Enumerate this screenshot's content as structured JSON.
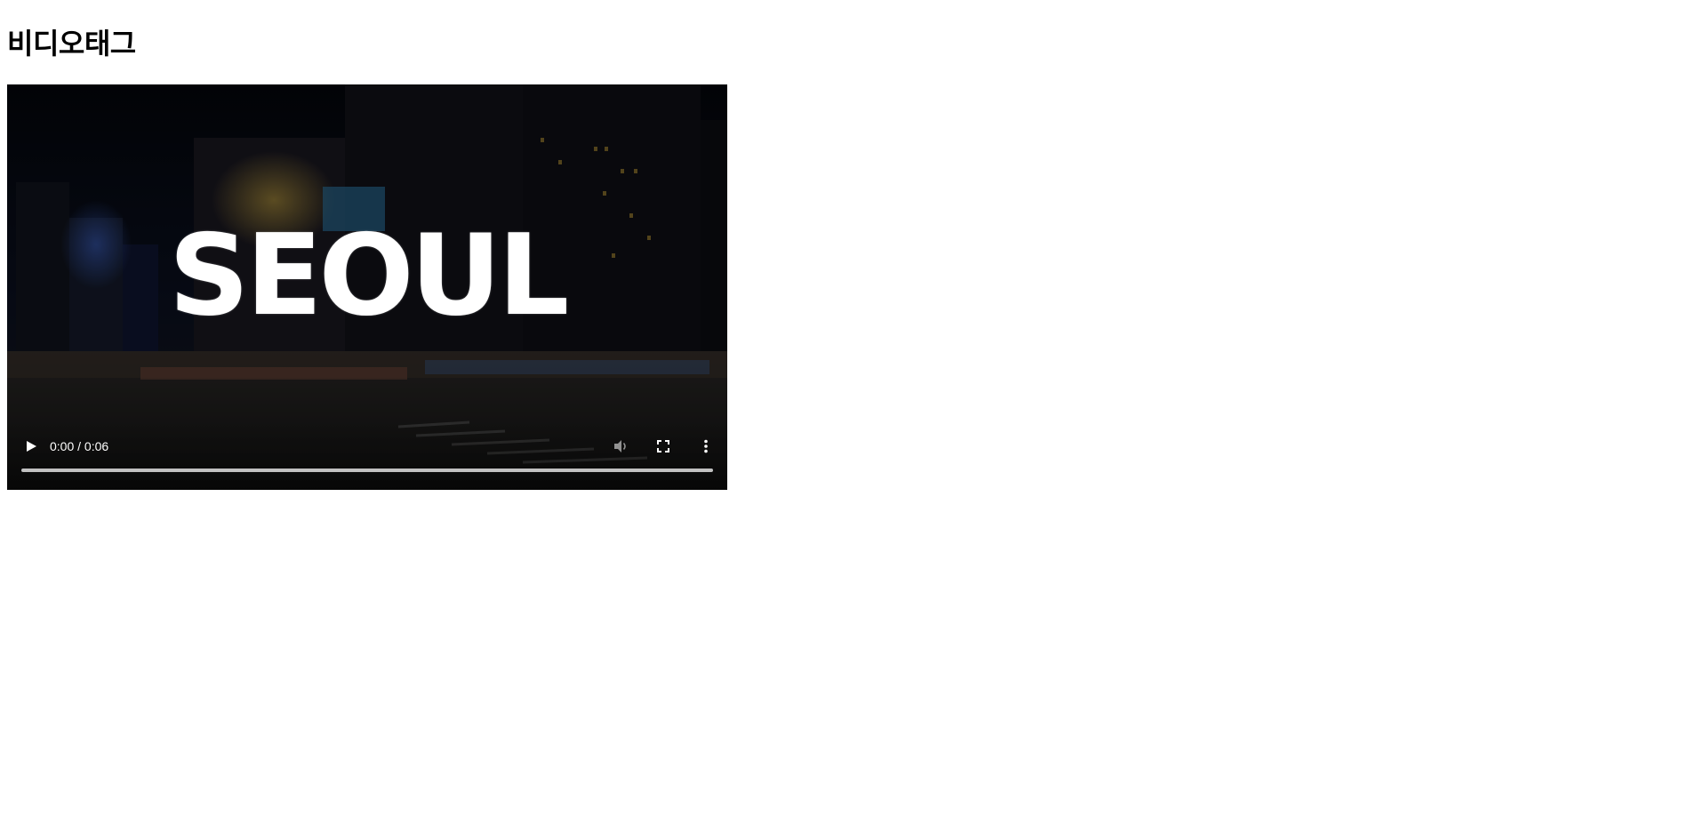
{
  "page": {
    "heading": "비디오태그"
  },
  "video": {
    "overlay_text": "SEOUL",
    "time_display": "0:00 / 0:06",
    "progress": 0,
    "icons": {
      "play": "play-icon",
      "mute": "volume-icon",
      "fullscreen": "fullscreen-icon",
      "more": "more-vertical-icon"
    },
    "colors": {
      "background": "#050608",
      "controls_text": "#ffffff",
      "progress_track": "#cfcfcf"
    }
  }
}
